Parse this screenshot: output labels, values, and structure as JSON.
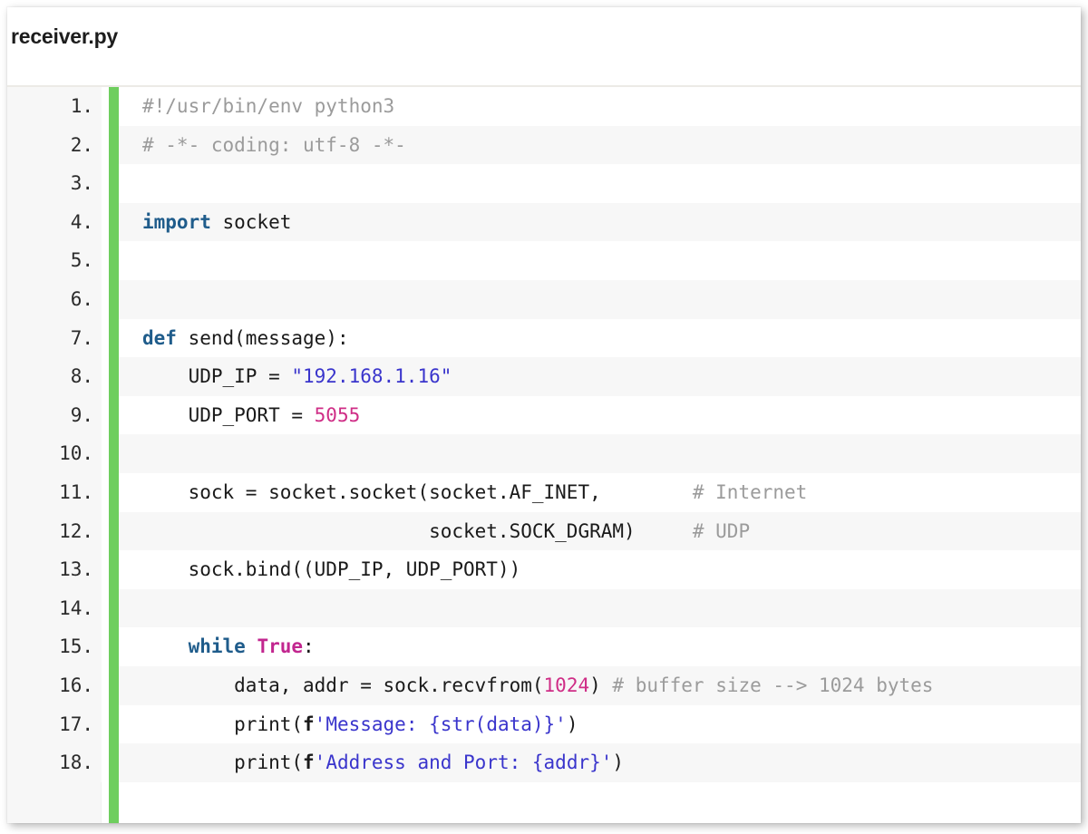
{
  "header": {
    "filename": "receiver.py"
  },
  "editor": {
    "language": "python",
    "accent_color": "#6ece5e",
    "gutter_color": "#f7f7f7",
    "stripe_color": "#f7f7f7",
    "colors": {
      "comment": "#9b9b9b",
      "keyword": "#1f5c8b",
      "builtin_constant": "#c2268f",
      "string": "#3a35cc",
      "number": "#cf2d86",
      "plain": "#1a1a1a"
    },
    "lines": [
      {
        "number": "1.",
        "text": "#!/usr/bin/env python3",
        "tokens": [
          {
            "t": "#!/usr/bin/env python3",
            "k": "com"
          }
        ]
      },
      {
        "number": "2.",
        "text": "# -*- coding: utf-8 -*-",
        "tokens": [
          {
            "t": "# -*- coding: utf-8 -*-",
            "k": "com"
          }
        ]
      },
      {
        "number": "3.",
        "text": "",
        "tokens": []
      },
      {
        "number": "4.",
        "text": "import socket",
        "tokens": [
          {
            "t": "import",
            "k": "kw"
          },
          {
            "t": " socket",
            "k": "pln"
          }
        ]
      },
      {
        "number": "5.",
        "text": "",
        "tokens": []
      },
      {
        "number": "6.",
        "text": "",
        "tokens": []
      },
      {
        "number": "7.",
        "text": "def send(message):",
        "tokens": [
          {
            "t": "def",
            "k": "kw"
          },
          {
            "t": " send(message):",
            "k": "pln"
          }
        ]
      },
      {
        "number": "8.",
        "text": "    UDP_IP = \"192.168.1.16\"",
        "tokens": [
          {
            "t": "    UDP_IP = ",
            "k": "pln"
          },
          {
            "t": "\"192.168.1.16\"",
            "k": "str"
          }
        ]
      },
      {
        "number": "9.",
        "text": "    UDP_PORT = 5055",
        "tokens": [
          {
            "t": "    UDP_PORT = ",
            "k": "pln"
          },
          {
            "t": "5055",
            "k": "num"
          }
        ]
      },
      {
        "number": "10.",
        "text": "",
        "tokens": []
      },
      {
        "number": "11.",
        "text": "    sock = socket.socket(socket.AF_INET,        # Internet",
        "tokens": [
          {
            "t": "    sock = socket.socket(socket.AF_INET,        ",
            "k": "pln"
          },
          {
            "t": "# Internet",
            "k": "com"
          }
        ]
      },
      {
        "number": "12.",
        "text": "                         socket.SOCK_DGRAM)     # UDP",
        "tokens": [
          {
            "t": "                         socket.SOCK_DGRAM)     ",
            "k": "pln"
          },
          {
            "t": "# UDP",
            "k": "com"
          }
        ]
      },
      {
        "number": "13.",
        "text": "    sock.bind((UDP_IP, UDP_PORT))",
        "tokens": [
          {
            "t": "    sock.bind((UDP_IP, UDP_PORT))",
            "k": "pln"
          }
        ]
      },
      {
        "number": "14.",
        "text": "",
        "tokens": []
      },
      {
        "number": "15.",
        "text": "    while True:",
        "tokens": [
          {
            "t": "    ",
            "k": "pln"
          },
          {
            "t": "while",
            "k": "kw"
          },
          {
            "t": " ",
            "k": "pln"
          },
          {
            "t": "True",
            "k": "kw2"
          },
          {
            "t": ":",
            "k": "pln"
          }
        ]
      },
      {
        "number": "16.",
        "text": "        data, addr = sock.recvfrom(1024) # buffer size --> 1024 bytes",
        "tokens": [
          {
            "t": "        data, addr = sock.recvfrom(",
            "k": "pln"
          },
          {
            "t": "1024",
            "k": "num"
          },
          {
            "t": ") ",
            "k": "pln"
          },
          {
            "t": "# buffer size --> 1024 bytes",
            "k": "com"
          }
        ]
      },
      {
        "number": "17.",
        "text": "        print(f'Message: {str(data)}')",
        "tokens": [
          {
            "t": "        print(",
            "k": "pln"
          },
          {
            "t": "f",
            "k": "fpx"
          },
          {
            "t": "'Message: {str(data)}'",
            "k": "str"
          },
          {
            "t": ")",
            "k": "pln"
          }
        ]
      },
      {
        "number": "18.",
        "text": "        print(f'Address and Port: {addr}')",
        "tokens": [
          {
            "t": "        print(",
            "k": "pln"
          },
          {
            "t": "f",
            "k": "fpx"
          },
          {
            "t": "'Address and Port: {addr}'",
            "k": "str"
          },
          {
            "t": ")",
            "k": "pln"
          }
        ]
      }
    ]
  }
}
